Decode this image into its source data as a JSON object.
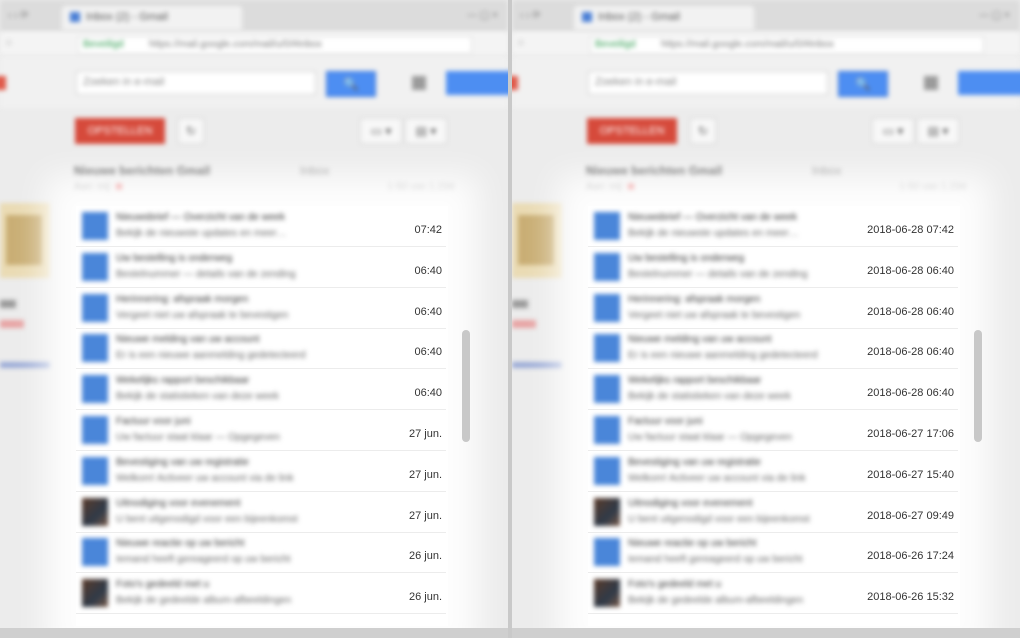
{
  "browser": {
    "tab_title": "Inbox (2) - Gmail",
    "tab_close": "×",
    "left_controls": "‹ › ⟳",
    "window_controls": "— ▢ ×",
    "secure_label": "Beveiligd",
    "url": "https://mail.google.com/mail/u/0/#inbox"
  },
  "gmail": {
    "search_placeholder": "Zoeken in e-mail",
    "search_button": "🔍",
    "compose_label": "OPSTELLEN",
    "refresh_label": "↻",
    "more_label": "▾",
    "tb_label_btn": "▭ ▾",
    "tb_move_btn": "▤ ▾"
  },
  "thread": {
    "subject": "Nieuwe berichten Gmail",
    "subject_extra": "Inbox",
    "meta": "Aan: mij",
    "meta_right": "1-50 van 1.234"
  },
  "emails": [
    {
      "line1": "Nieuwsbrief — Overzicht van de week",
      "line2": "Bekijk de nieuwste updates en meer…",
      "date_short": "07:42",
      "date_full": "2018-06-28 07:42",
      "avatar": "blue"
    },
    {
      "line1": "Uw bestelling is onderweg",
      "line2": "Bestelnummer — details van de zending",
      "date_short": "06:40",
      "date_full": "2018-06-28 06:40",
      "avatar": "blue"
    },
    {
      "line1": "Herinnering: afspraak morgen",
      "line2": "Vergeet niet uw afspraak te bevestigen",
      "date_short": "06:40",
      "date_full": "2018-06-28 06:40",
      "avatar": "blue"
    },
    {
      "line1": "Nieuwe melding van uw account",
      "line2": "Er is een nieuwe aanmelding gedetecteerd",
      "date_short": "06:40",
      "date_full": "2018-06-28 06:40",
      "avatar": "blue"
    },
    {
      "line1": "Wekelijks rapport beschikbaar",
      "line2": "Bekijk de statistieken van deze week",
      "date_short": "06:40",
      "date_full": "2018-06-28 06:40",
      "avatar": "blue"
    },
    {
      "line1": "Factuur voor juni",
      "line2": "Uw factuur staat klaar — Opgegeven",
      "date_short": "27 jun.",
      "date_full": "2018-06-27 17:06",
      "avatar": "blue",
      "extra": "Opgegeven"
    },
    {
      "line1": "Bevestiging van uw registratie",
      "line2": "Welkom! Activeer uw account via de link",
      "date_short": "27 jun.",
      "date_full": "2018-06-27 15:40",
      "avatar": "blue"
    },
    {
      "line1": "Uitnodiging voor evenement",
      "line2": "U bent uitgenodigd voor een bijeenkomst",
      "date_short": "27 jun.",
      "date_full": "2018-06-27 09:49",
      "avatar": "photo"
    },
    {
      "line1": "Nieuwe reactie op uw bericht",
      "line2": "Iemand heeft gereageerd op uw bericht",
      "date_short": "26 jun.",
      "date_full": "2018-06-26 17:24",
      "avatar": "blue"
    },
    {
      "line1": "Foto's gedeeld met u",
      "line2": "Bekijk de gedeelde album-afbeeldingen",
      "date_short": "26 jun.",
      "date_full": "2018-06-26 15:32",
      "avatar": "photo"
    }
  ]
}
